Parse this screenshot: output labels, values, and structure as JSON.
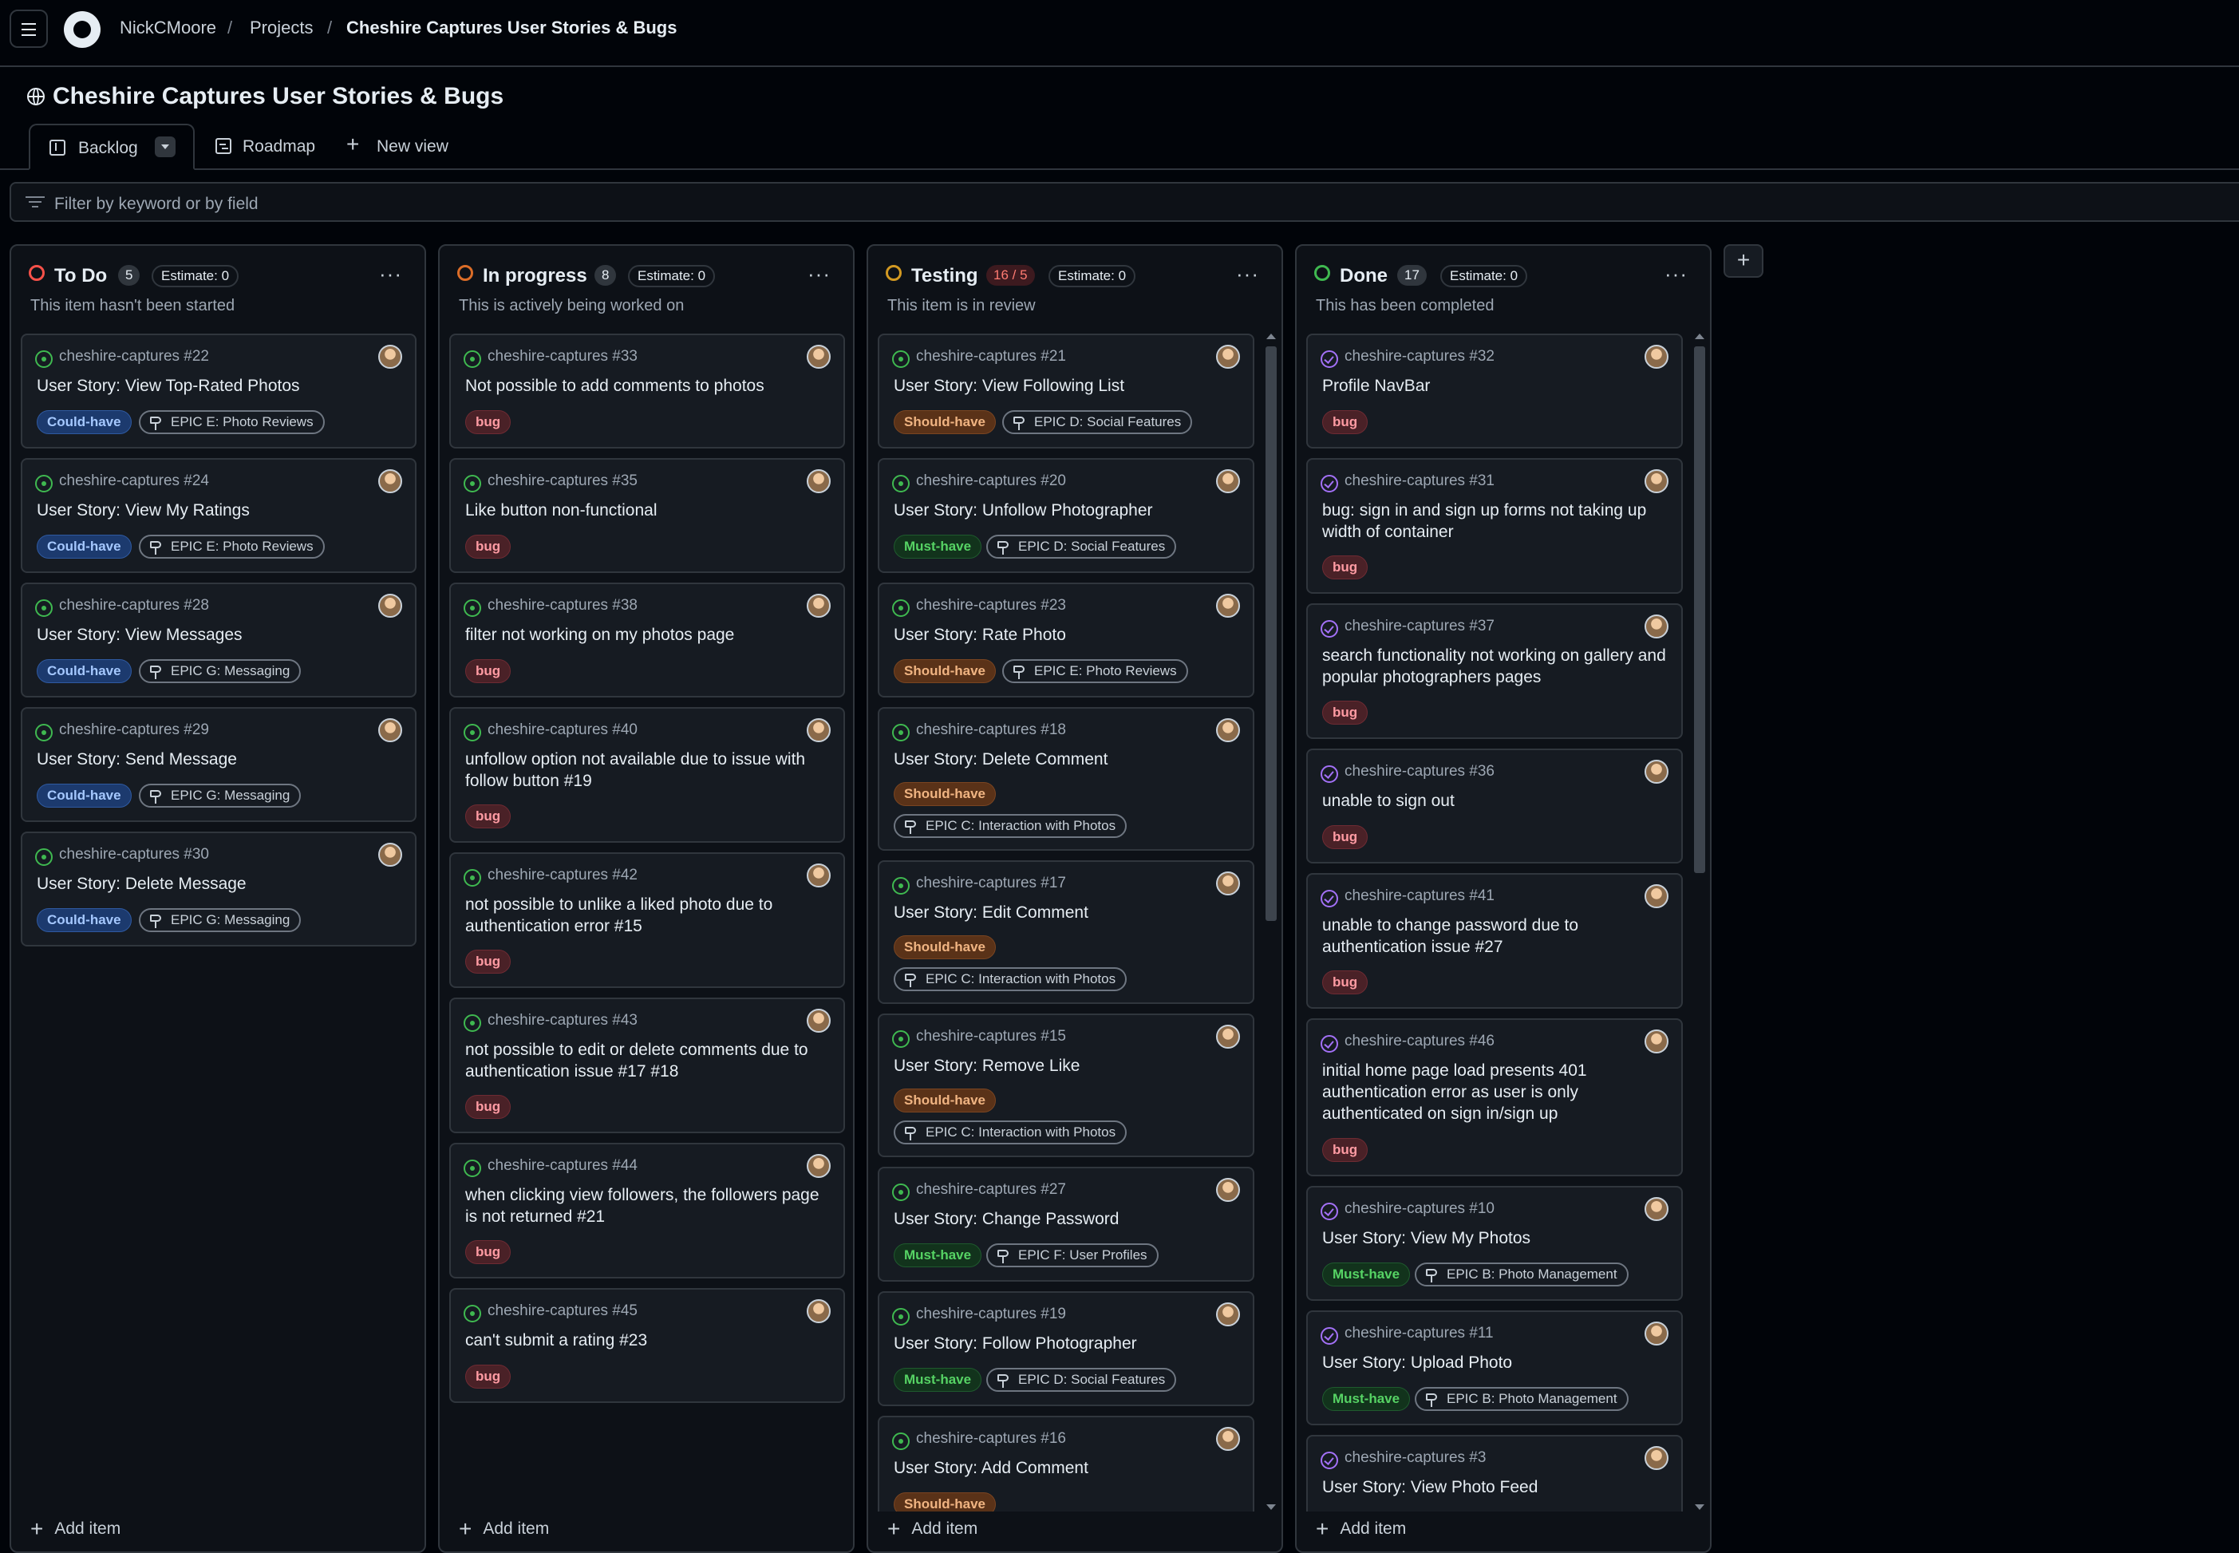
{
  "header": {
    "owner": "NickCMoore",
    "projects": "Projects",
    "project_name": "Cheshire Captures User Stories & Bugs",
    "separator": "/"
  },
  "project": {
    "title": "Cheshire Captures User Stories & Bugs"
  },
  "views": {
    "backlog": "Backlog",
    "roadmap": "Roadmap",
    "new_view": "New view"
  },
  "filter": {
    "placeholder": "Filter by keyword or by field"
  },
  "icons": {
    "menu": "hamburger-icon",
    "logo": "github-logo",
    "globe": "globe-icon",
    "board": "board-icon",
    "table": "roadmap-icon",
    "filter": "filter-icon",
    "issue_open": "issue-open-icon",
    "issue_closed": "issue-closed-icon",
    "milestone": "milestone-icon",
    "more": "kebab-icon",
    "add": "plus-icon"
  },
  "colors": {
    "todo": "#f85149",
    "in_progress": "#db6d28",
    "testing": "#d29922",
    "done": "#3fb950"
  },
  "columns": [
    {
      "name": "To Do",
      "count": "5",
      "estimate": "Estimate: 0",
      "description": "This item hasn't been started",
      "add_item": "Add item",
      "more": "···",
      "cards": [
        {
          "ref": "cheshire-captures #22",
          "title": "User Story: View Top-Rated Photos",
          "labels": [
            "Could-have"
          ],
          "epic": "EPIC E: Photo Reviews"
        },
        {
          "ref": "cheshire-captures #24",
          "title": "User Story: View My Ratings",
          "labels": [
            "Could-have"
          ],
          "epic": "EPIC E: Photo Reviews"
        },
        {
          "ref": "cheshire-captures #28",
          "title": "User Story: View Messages",
          "labels": [
            "Could-have"
          ],
          "epic": "EPIC G: Messaging"
        },
        {
          "ref": "cheshire-captures #29",
          "title": "User Story: Send Message",
          "labels": [
            "Could-have"
          ],
          "epic": "EPIC G: Messaging"
        },
        {
          "ref": "cheshire-captures #30",
          "title": "User Story: Delete Message",
          "labels": [
            "Could-have"
          ],
          "epic": "EPIC G: Messaging"
        }
      ]
    },
    {
      "name": "In progress",
      "count": "8",
      "estimate": "Estimate: 0",
      "description": "This is actively being worked on",
      "add_item": "Add item",
      "more": "···",
      "cards": [
        {
          "ref": "cheshire-captures #33",
          "title": "Not possible to add comments to photos",
          "labels": [
            "bug"
          ]
        },
        {
          "ref": "cheshire-captures #35",
          "title": "Like button non-functional",
          "labels": [
            "bug"
          ]
        },
        {
          "ref": "cheshire-captures #38",
          "title": "filter not working on my photos page",
          "labels": [
            "bug"
          ]
        },
        {
          "ref": "cheshire-captures #40",
          "title": "unfollow option not available due to issue with follow button #19",
          "labels": [
            "bug"
          ]
        },
        {
          "ref": "cheshire-captures #42",
          "title": "not possible to unlike a liked photo due to authentication error #15",
          "labels": [
            "bug"
          ]
        },
        {
          "ref": "cheshire-captures #43",
          "title": "not possible to edit or delete comments due to authentication issue #17 #18",
          "labels": [
            "bug"
          ]
        },
        {
          "ref": "cheshire-captures #44",
          "title": "when clicking view followers, the followers page is not returned #21",
          "labels": [
            "bug"
          ]
        },
        {
          "ref": "cheshire-captures #45",
          "title": "can't submit a rating #23",
          "labels": [
            "bug"
          ]
        }
      ]
    },
    {
      "name": "Testing",
      "count": "16 / 5",
      "estimate": "Estimate: 0",
      "description": "This item is in review",
      "add_item": "Add item",
      "more": "···",
      "cards": [
        {
          "ref": "cheshire-captures #21",
          "title": "User Story: View Following List",
          "labels": [
            "Should-have"
          ],
          "epic": "EPIC D: Social Features"
        },
        {
          "ref": "cheshire-captures #20",
          "title": "User Story: Unfollow Photographer",
          "labels": [
            "Must-have"
          ],
          "epic": "EPIC D: Social Features"
        },
        {
          "ref": "cheshire-captures #23",
          "title": "User Story: Rate Photo",
          "labels": [
            "Should-have"
          ],
          "epic": "EPIC E: Photo Reviews"
        },
        {
          "ref": "cheshire-captures #18",
          "title": "User Story: Delete Comment",
          "labels": [
            "Should-have"
          ],
          "epic": "EPIC C: Interaction with Photos"
        },
        {
          "ref": "cheshire-captures #17",
          "title": "User Story: Edit Comment",
          "labels": [
            "Should-have"
          ],
          "epic": "EPIC C: Interaction with Photos"
        },
        {
          "ref": "cheshire-captures #15",
          "title": "User Story: Remove Like",
          "labels": [
            "Should-have"
          ],
          "epic": "EPIC C: Interaction with Photos"
        },
        {
          "ref": "cheshire-captures #27",
          "title": "User Story: Change Password",
          "labels": [
            "Must-have"
          ],
          "epic": "EPIC F: User Profiles"
        },
        {
          "ref": "cheshire-captures #19",
          "title": "User Story: Follow Photographer",
          "labels": [
            "Must-have"
          ],
          "epic": "EPIC D: Social Features"
        },
        {
          "ref": "cheshire-captures #16",
          "title": "User Story: Add Comment",
          "labels": [
            "Should-have"
          ]
        }
      ]
    },
    {
      "name": "Done",
      "count": "17",
      "estimate": "Estimate: 0",
      "description": "This has been completed",
      "add_item": "Add item",
      "more": "···",
      "cards": [
        {
          "ref": "cheshire-captures #32",
          "title": "Profile NavBar",
          "labels": [
            "bug"
          ]
        },
        {
          "ref": "cheshire-captures #31",
          "title": "bug: sign in and sign up forms not taking up width of container",
          "labels": [
            "bug"
          ]
        },
        {
          "ref": "cheshire-captures #37",
          "title": "search functionality not working on gallery and popular photographers pages",
          "labels": [
            "bug"
          ]
        },
        {
          "ref": "cheshire-captures #36",
          "title": "unable to sign out",
          "labels": [
            "bug"
          ]
        },
        {
          "ref": "cheshire-captures #41",
          "title": "unable to change password due to authentication issue #27",
          "labels": [
            "bug"
          ]
        },
        {
          "ref": "cheshire-captures #46",
          "title": "initial home page load presents 401 authentication error as user is only authenticated on sign in/sign up",
          "labels": [
            "bug"
          ]
        },
        {
          "ref": "cheshire-captures #10",
          "title": "User Story: View My Photos",
          "labels": [
            "Must-have"
          ],
          "epic": "EPIC B: Photo Management"
        },
        {
          "ref": "cheshire-captures #11",
          "title": "User Story: Upload Photo",
          "labels": [
            "Must-have"
          ],
          "epic": "EPIC B: Photo Management"
        },
        {
          "ref": "cheshire-captures #3",
          "title": "User Story: View Photo Feed",
          "labels": []
        }
      ]
    }
  ],
  "add_column": "+"
}
